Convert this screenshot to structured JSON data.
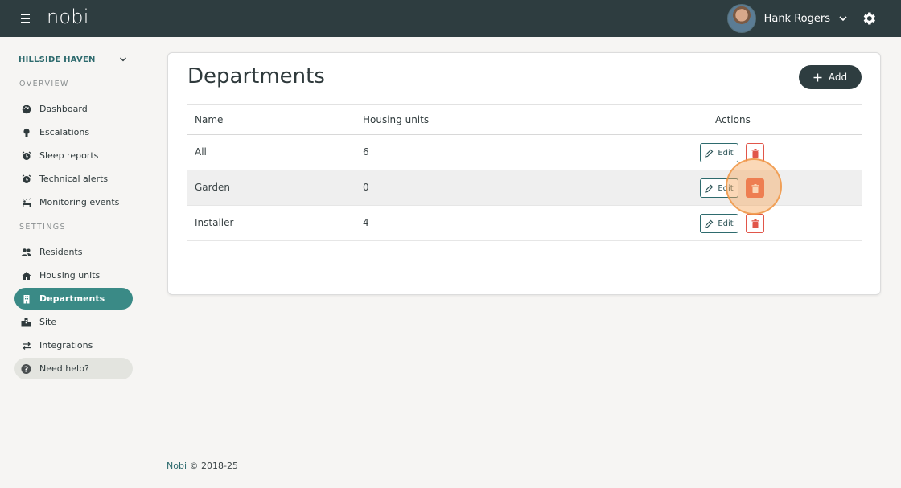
{
  "topbar": {
    "logo": "nobi",
    "user_name": "Hank Rogers"
  },
  "sidebar": {
    "site_name": "HILLSIDE HAVEN",
    "overview_label": "OVERVIEW",
    "settings_label": "SETTINGS",
    "overview_items": [
      {
        "label": "Dashboard",
        "icon": "dashboard-icon"
      },
      {
        "label": "Escalations",
        "icon": "lightbulb-icon"
      },
      {
        "label": "Sleep reports",
        "icon": "alarm-clock-icon"
      },
      {
        "label": "Technical alerts",
        "icon": "alarm-clock-icon"
      },
      {
        "label": "Monitoring events",
        "icon": "bed-icon"
      }
    ],
    "settings_items": [
      {
        "label": "Residents",
        "icon": "people-icon"
      },
      {
        "label": "Housing units",
        "icon": "house-icon"
      },
      {
        "label": "Departments",
        "icon": "building-icon",
        "active": true
      },
      {
        "label": "Site",
        "icon": "city-icon"
      },
      {
        "label": "Integrations",
        "icon": "swap-arrows-icon"
      }
    ],
    "help_label": "Need help?"
  },
  "main": {
    "title": "Departments",
    "add_label": "Add",
    "columns": [
      "Name",
      "Housing units",
      "Actions"
    ],
    "rows": [
      {
        "name": "All",
        "housing_units": "6"
      },
      {
        "name": "Garden",
        "housing_units": "0"
      },
      {
        "name": "Installer",
        "housing_units": "4"
      }
    ],
    "edit_label": "Edit"
  },
  "footer": {
    "brand": "Nobi",
    "copyright": "© 2018-25"
  },
  "colors": {
    "topbar": "#2e3d40",
    "accent": "#3a8a86",
    "danger": "#e85b45",
    "background": "#f6f5f3"
  }
}
